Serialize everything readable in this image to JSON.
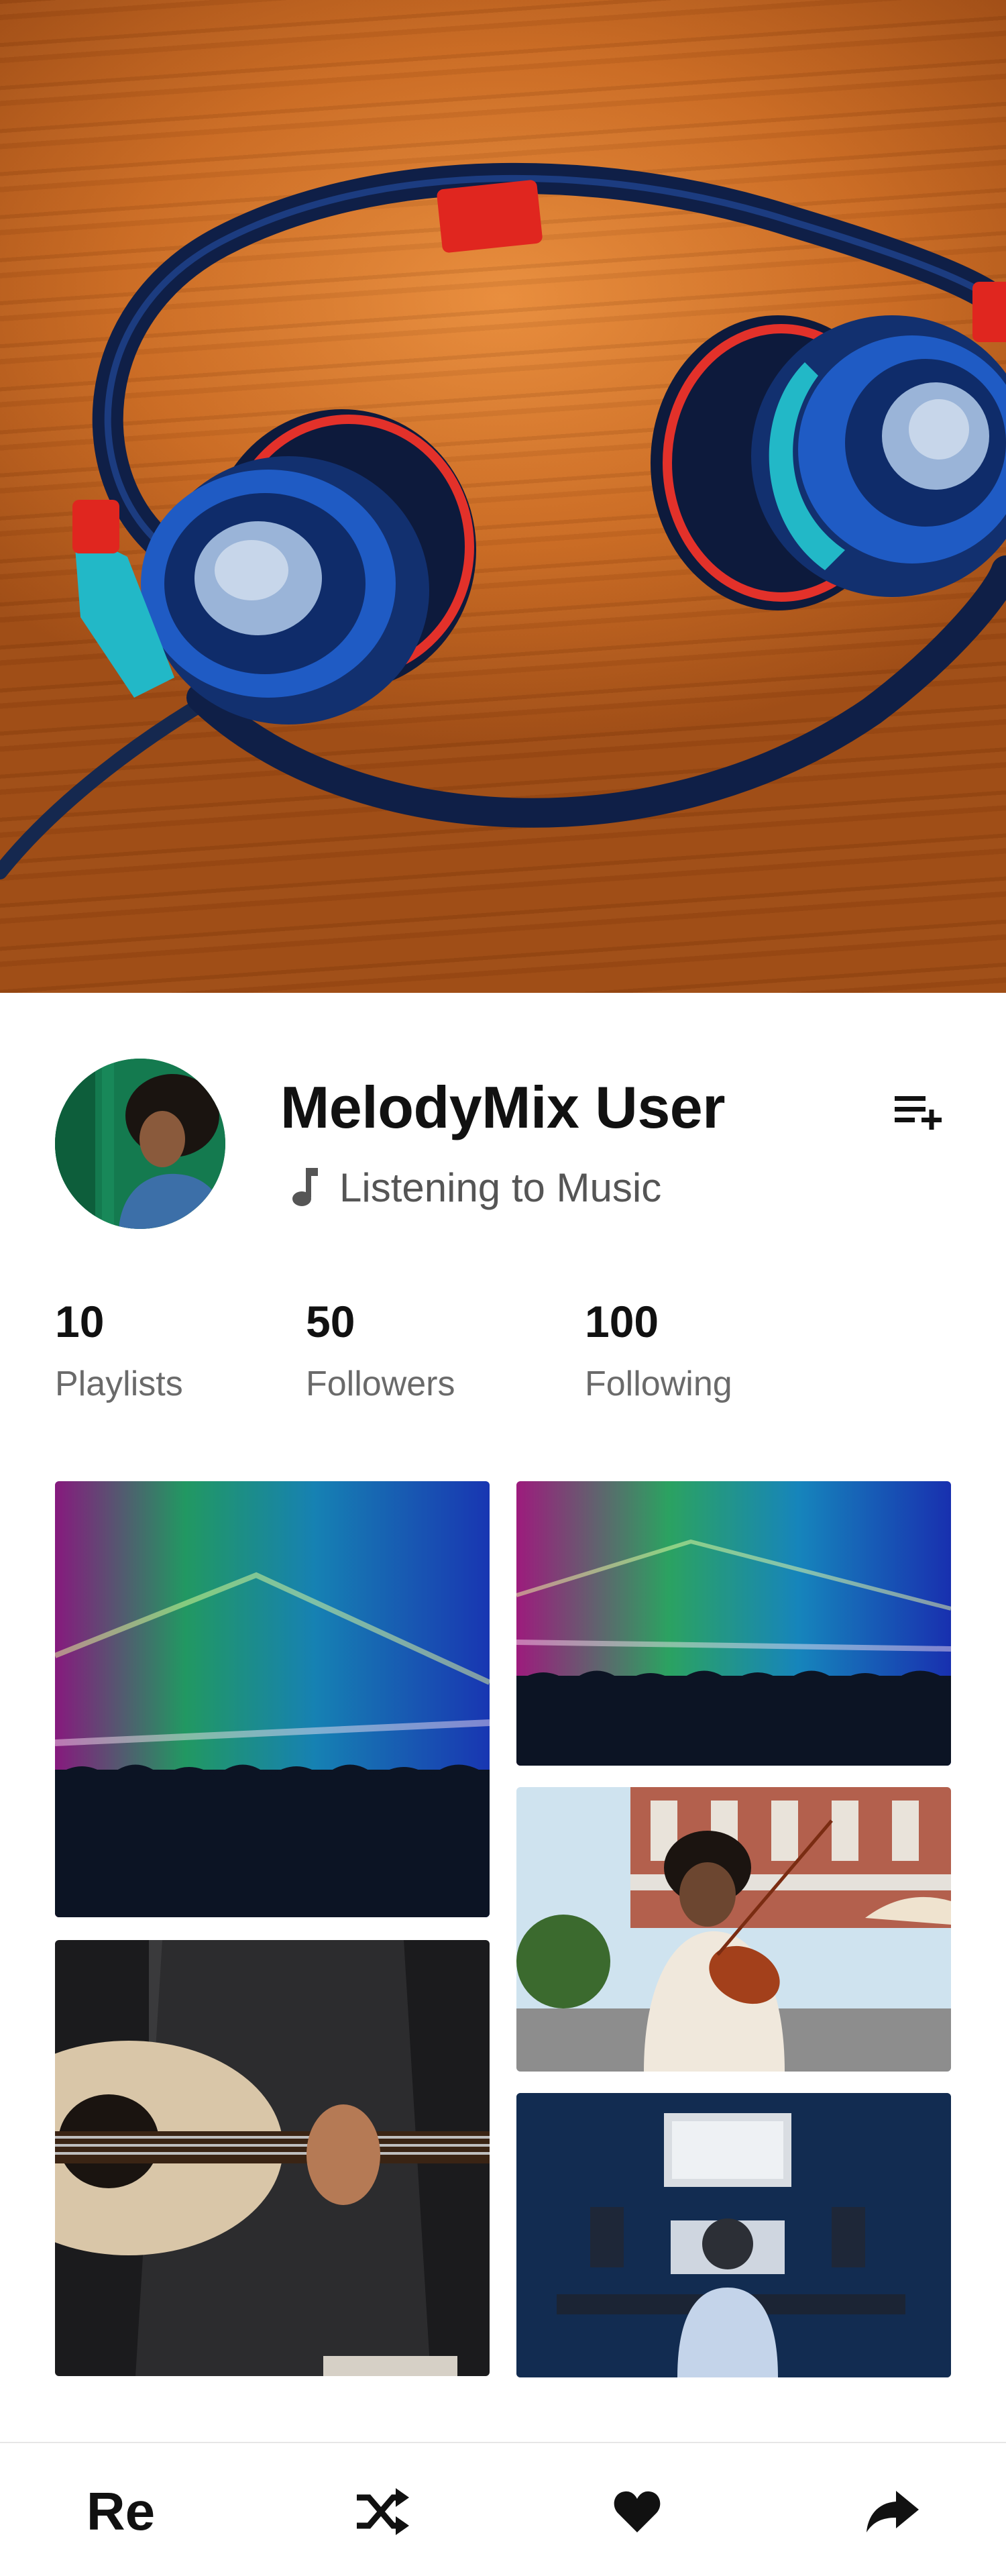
{
  "profile": {
    "name": "MelodyMix User",
    "status": "Listening to Music"
  },
  "stats": [
    {
      "value": "10",
      "label": "Playlists"
    },
    {
      "value": "50",
      "label": "Followers"
    },
    {
      "value": "100",
      "label": "Following"
    }
  ],
  "bottom_bar": {
    "left_label": "Re"
  },
  "icons": {
    "queue": "playlist-add-icon",
    "status": "music-note-icon",
    "shuffle": "shuffle-icon",
    "like": "heart-icon",
    "share": "share-icon"
  },
  "colors": {
    "text_primary": "#111111",
    "text_secondary": "#6a6a6a",
    "divider": "#e6e6e6"
  }
}
